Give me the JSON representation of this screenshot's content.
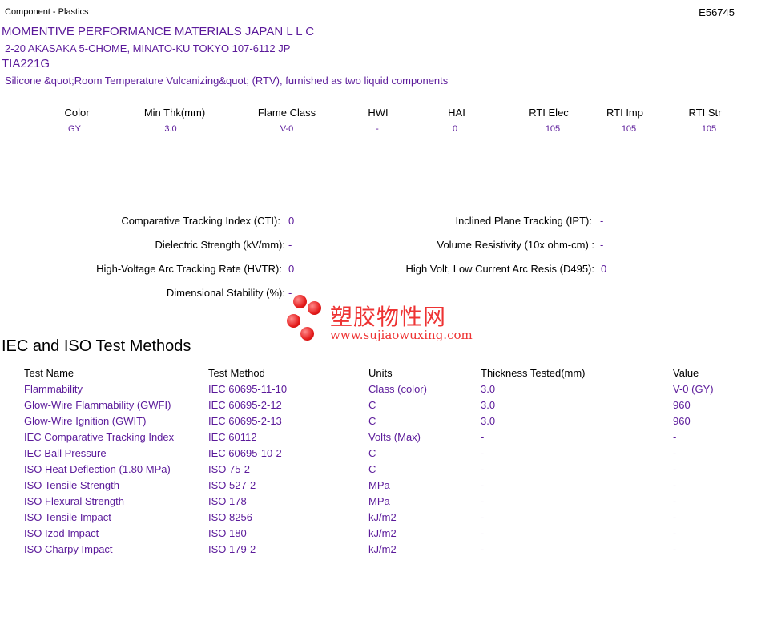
{
  "header": {
    "category": "Component - Plastics",
    "file_number": "E56745"
  },
  "company": {
    "name": "MOMENTIVE PERFORMANCE MATERIALS JAPAN L L C",
    "address": "2-20 AKASAKA 5-CHOME, MINATO-KU  TOKYO  107-6112 JP",
    "product": "TIA221G",
    "description": "Silicone &quot;Room Temperature Vulcanizing&quot; (RTV), furnished as two liquid components"
  },
  "summary": {
    "headers": [
      "Color",
      "Min Thk(mm)",
      "Flame Class",
      "HWI",
      "HAI",
      "RTI Elec",
      "RTI Imp",
      "RTI Str"
    ],
    "values": [
      "GY",
      "3.0",
      "V-0",
      "-",
      "0",
      "105",
      "105",
      "105"
    ]
  },
  "properties": {
    "left": [
      {
        "label": "Comparative Tracking Index (CTI):",
        "value": "0"
      },
      {
        "label": "Dielectric Strength (kV/mm):",
        "value": "-"
      },
      {
        "label": "High-Voltage Arc Tracking Rate (HVTR):",
        "value": "0"
      },
      {
        "label": "Dimensional Stability (%):",
        "value": "-"
      }
    ],
    "right": [
      {
        "label": "Inclined Plane Tracking (IPT):",
        "value": "-"
      },
      {
        "label": "Volume Resistivity (10x ohm-cm) :",
        "value": "-"
      },
      {
        "label": "High Volt, Low Current Arc Resis (D495):",
        "value": "0"
      }
    ]
  },
  "watermark": {
    "chinese": "塑胶物性网",
    "url": "www.sujiaowuxing.com"
  },
  "test_section": {
    "title": "IEC and ISO Test Methods",
    "headers": [
      "Test Name",
      "Test Method",
      "Units",
      "Thickness Tested(mm)",
      "Value"
    ],
    "rows": [
      [
        "Flammability",
        "IEC 60695-11-10",
        "Class (color)",
        "3.0",
        "V-0 (GY)"
      ],
      [
        "Glow-Wire Flammability (GWFI)",
        "IEC 60695-2-12",
        "C",
        "3.0",
        "960"
      ],
      [
        "Glow-Wire Ignition (GWIT)",
        "IEC 60695-2-13",
        "C",
        "3.0",
        "960"
      ],
      [
        "IEC Comparative Tracking Index",
        "IEC 60112",
        "Volts (Max)",
        "-",
        "-"
      ],
      [
        "IEC Ball Pressure",
        "IEC 60695-10-2",
        "C",
        "-",
        "-"
      ],
      [
        "ISO Heat Deflection (1.80 MPa)",
        "ISO 75-2",
        "C",
        "-",
        "-"
      ],
      [
        "ISO Tensile Strength",
        "ISO 527-2",
        "MPa",
        "-",
        "-"
      ],
      [
        "ISO Flexural Strength",
        "ISO 178",
        "MPa",
        "-",
        "-"
      ],
      [
        "ISO Tensile Impact",
        "ISO 8256",
        "kJ/m2",
        "-",
        "-"
      ],
      [
        "ISO Izod Impact",
        "ISO 180",
        "kJ/m2",
        "-",
        "-"
      ],
      [
        "ISO Charpy Impact",
        "ISO 179-2",
        "kJ/m2",
        "-",
        "-"
      ]
    ]
  },
  "colors": {
    "accent": "#5b1a9a",
    "watermark": "#e33333"
  }
}
